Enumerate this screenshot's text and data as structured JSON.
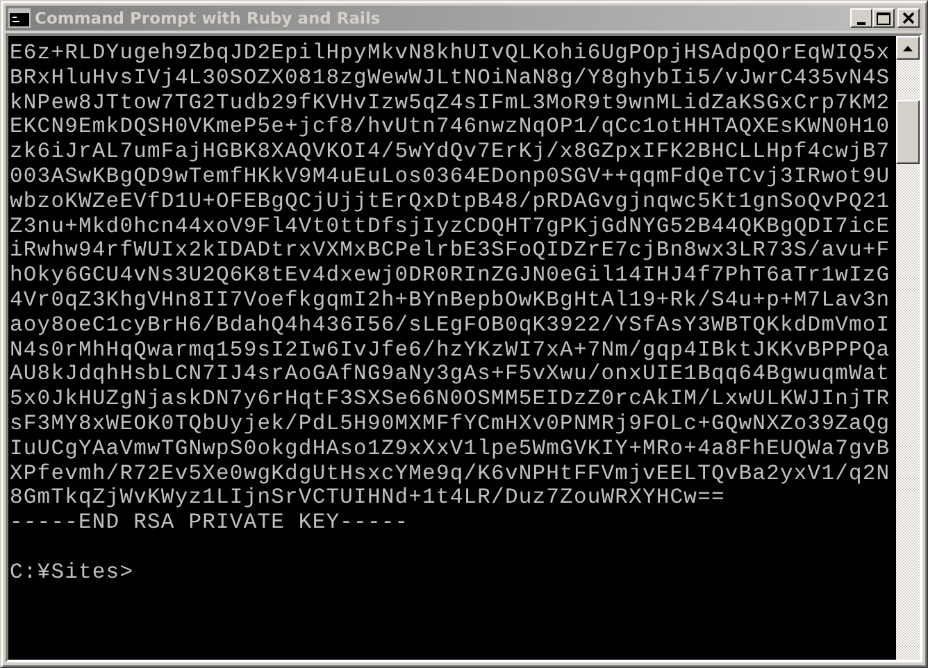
{
  "window": {
    "title": "Command Prompt with Ruby and Rails",
    "active": false
  },
  "console": {
    "lines": [
      "E6z+RLDYugeh9ZbqJD2EpilHpyMkvN8khUIvQLKohi6UgPOpjHSAdpQOrEqWIQ5x",
      "BRxHluHvsIVj4L30SOZX0818zgWewWJLtNOiNaN8g/Y8ghybIi5/vJwrC435vN4S",
      "kNPew8JTtow7TG2Tudb29fKVHvIzw5qZ4sIFmL3MoR9t9wnMLidZaKSGxCrp7KM2",
      "EKCN9EmkDQSH0VKmeP5e+jcf8/hvUtn746nwzNqOP1/qCc1otHHTAQXEsKWN0H10",
      "zk6iJrAL7umFajHGBK8XAQVKOI4/5wYdQv7ErKj/x8GZpxIFK2BHCLLHpf4cwjB7",
      "003ASwKBgQD9wTemfHKkV9M4uEuLos0364EDonp0SGV++qqmFdQeTCvj3IRwot9U",
      "wbzoKWZeEVfD1U+OFEBgQCjUjjtErQxDtpB48/pRDAGvgjnqwc5Kt1gnSoQvPQ21",
      "Z3nu+Mkd0hcn44xoV9Fl4Vt0ttDfsjIyzCDQHT7gPKjGdNYG52B44QKBgQDI7icE",
      "iRwhw94rfWUIx2kIDADtrxVXMxBCPelrbE3SFoQIDZrE7cjBn8wx3LR73S/avu+F",
      "hOky6GCU4vNs3U2Q6K8tEv4dxewj0DR0RInZGJN0eGil14IHJ4f7PhT6aTr1wIzG",
      "4Vr0qZ3KhgVHn8II7VoefkgqmI2h+BYnBepbOwKBgHtAl19+Rk/S4u+p+M7Lav3n",
      "aoy8oeC1cyBrH6/BdahQ4h436I56/sLEgFOB0qK3922/YSfAsY3WBTQKkdDmVmoI",
      "N4s0rMhHqQwarmq159sI2Iw6IvJfe6/hzYKzWI7xA+7Nm/gqp4IBktJKKvBPPPQa",
      "AU8kJdqhHsbLCN7IJ4srAoGAfNG9aNy3gAs+F5vXwu/onxUIE1Bqq64BgwuqmWat",
      "5x0JkHUZgNjaskDN7y6rHqtF3SXSe66N0OSMM5EIDzZ0rcAkIM/LxwULKWJInjTR",
      "sF3MY8xWEOK0TQbUyjek/PdL5H90MXMFfYCmHXv0PNMRj9FOLc+GQwNXZo39ZaQg",
      "IuUCgYAaVmwTGNwpS0okgdHAso1Z9xXxV1lpe5WmGVKIY+MRo+4a8FhEUQWa7gvB",
      "XPfevmh/R72Ev5Xe0wgKdgUtHsxcYMe9q/K6vNPHtFFVmjvEELTQvBa2yxV1/q2N",
      "8GmTkqZjWvKWyz1LIjnSrVCTUIHNd+1t4LR/Duz7ZouWRXYHCw==",
      "-----END RSA PRIVATE KEY-----"
    ],
    "prompt": "C:¥Sites>"
  }
}
